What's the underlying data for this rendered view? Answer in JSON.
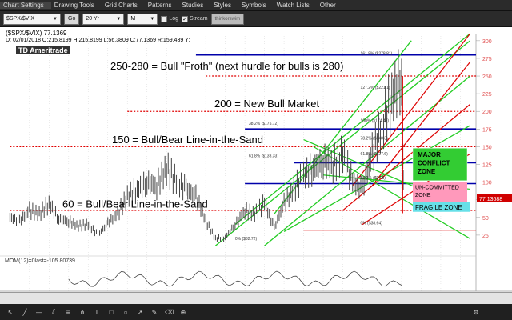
{
  "menu": {
    "items": [
      {
        "label": "Chart Settings"
      },
      {
        "label": "Drawing Tools"
      },
      {
        "label": "Grid Charts"
      },
      {
        "label": "Patterns"
      },
      {
        "label": "Studies"
      },
      {
        "label": "Styles"
      },
      {
        "label": "Symbols"
      },
      {
        "label": "Watch Lists"
      },
      {
        "label": "Other"
      }
    ]
  },
  "toolbar": {
    "symbol_value": "$SPX/$VIX",
    "go_label": "Go",
    "period_value": "20 Yr",
    "interval_value": "M",
    "log_label": "Log",
    "stream_label": "Stream",
    "stream_checked": "✓",
    "brand_label": "thinkorswim"
  },
  "chart": {
    "symbol_line": "($SPX/$VIX)   77.1369",
    "ohlc_line": "D: 02/01/2018  O:215.8199 H:215.8199 L:56.3809 C:77.1369     R:159.439   Y:",
    "logo_text": "TD Ameritrade",
    "momentum_label": "MOM(12)=0last=-105.80739",
    "last_price_label": "77.13688",
    "y_ticks": [
      "300",
      "275",
      "250",
      "225",
      "200",
      "175",
      "150",
      "125",
      "100",
      "75",
      "50",
      "25"
    ],
    "x_ticks": [
      "98",
      "99",
      "00",
      "01",
      "02",
      "03",
      "04",
      "05",
      "06",
      "07",
      "08",
      "09",
      "10",
      "11",
      "12",
      "13",
      "14",
      "15",
      "16",
      "17",
      "18",
      "19",
      "20",
      "21"
    ],
    "annotations": {
      "froth": "250-280 = Bull \"Froth\" (next hurdle for bulls is 280)",
      "bull_market": "200 = New Bull Market",
      "line150": "150 = Bull/Bear Line-in-the-Sand",
      "line60": "60 = Bull/Bear Line-in-the-Sand",
      "major_conflict": "MAJOR CONFLICT ZONE",
      "uncommitted": "UN-COMMITTED ZONE",
      "fragile": "FRAGILE ZONE"
    },
    "fib_labels": [
      "161.8% ($278.81)",
      "127.2% ($221.1)",
      "100% ($174.47)",
      "78.2% ($148.3)",
      "61.8% ($127.6)",
      "38.2% ($97.8)",
      "0% ($38.64)",
      "38.2% ($175.72)",
      "61.8% ($133.33)",
      "0% ($32.72)"
    ]
  },
  "chart_data": {
    "type": "line",
    "title": "($SPX/$VIX)",
    "ylim": [
      0,
      310
    ],
    "x": [
      1998,
      1998.5,
      1999,
      1999.5,
      2000,
      2000.5,
      2001,
      2001.5,
      2002,
      2002.5,
      2003,
      2003.5,
      2004,
      2004.5,
      2005,
      2005.5,
      2006,
      2006.5,
      2007,
      2007.5,
      2008,
      2008.5,
      2009,
      2009.5,
      2010,
      2010.5,
      2011,
      2011.5,
      2012,
      2012.5,
      2013,
      2013.5,
      2014,
      2014.5,
      2015,
      2015.5,
      2016,
      2016.5,
      2017,
      2017.5,
      2018,
      2018.1
    ],
    "series": [
      {
        "values": [
          50,
          45,
          60,
          55,
          70,
          48,
          45,
          38,
          40,
          25,
          42,
          55,
          80,
          90,
          100,
          95,
          120,
          100,
          90,
          80,
          45,
          20,
          22,
          40,
          60,
          55,
          70,
          35,
          70,
          90,
          110,
          120,
          130,
          125,
          140,
          100,
          90,
          140,
          180,
          220,
          250,
          77
        ]
      }
    ],
    "horizontal_levels": [
      280,
      250,
      200,
      175,
      150,
      127.6,
      97.8,
      60
    ],
    "colors": {
      "froth_line": "#e00000",
      "level_line": "#0000aa",
      "green_channel": "#22cc22",
      "red_channel": "#dd0000"
    }
  }
}
